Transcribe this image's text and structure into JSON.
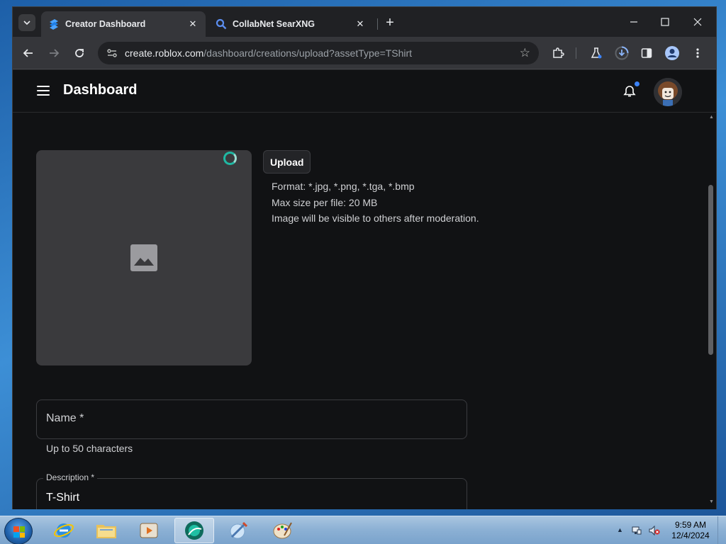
{
  "browser": {
    "tabs": [
      {
        "title": "Creator Dashboard",
        "favicon": "roblox-studio-icon",
        "active": true
      },
      {
        "title": "CollabNet SearXNG",
        "favicon": "search-icon",
        "active": false
      }
    ],
    "url_host": "create.roblox.com",
    "url_path": "/dashboard/creations/upload?assetType=TShirt"
  },
  "app": {
    "title": "Dashboard",
    "notification_color": "#3b82f6"
  },
  "upload": {
    "button_label": "Upload",
    "rules": [
      "Format: *.jpg, *.png, *.tga, *.bmp",
      "Max size per file: 20 MB",
      "Image will be visible to others after moderation."
    ]
  },
  "form": {
    "name_label": "Name *",
    "name_helper": "Up to 50 characters",
    "description_label": "Description *",
    "description_value": "T-Shirt"
  },
  "taskbar": {
    "apps": [
      "internet-explorer-icon",
      "file-explorer-icon",
      "media-player-icon",
      "browser-icon",
      "paint-brush-icon",
      "palette-icon"
    ],
    "time": "9:59 AM",
    "date": "12/4/2024"
  }
}
